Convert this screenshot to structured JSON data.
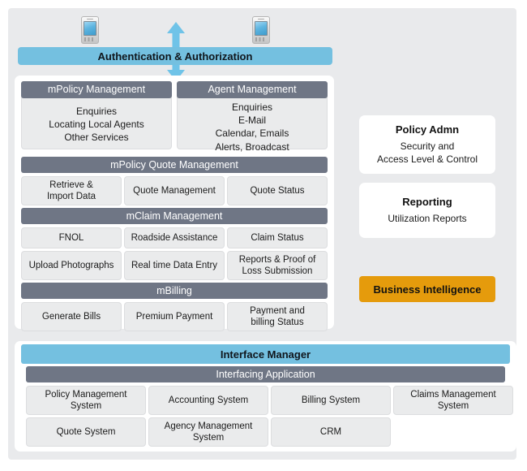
{
  "diagram": {
    "devices": [
      {
        "icon": "mobile-phone-icon"
      },
      {
        "icon": "mobile-phone-icon"
      }
    ],
    "arrow": {
      "icon": "double-headed-vertical-arrow-icon"
    },
    "auth_bar": {
      "label": "Authentication & Authorization"
    },
    "modules": [
      {
        "id": "mpolicy-management",
        "title": "mPolicy Management",
        "body": [
          "Enquiries",
          "Locating Local Agents",
          "Other Services"
        ]
      },
      {
        "id": "agent-management",
        "title": "Agent Management",
        "body": [
          "Enquiries",
          "E-Mail",
          "Calendar, Emails",
          "Alerts, Broadcast"
        ]
      }
    ],
    "sections": [
      {
        "id": "mpolicy-quote-management",
        "title": "mPolicy Quote Management",
        "rows": [
          [
            "Retrieve &\nImport Data",
            "Quote Management",
            "Quote Status"
          ]
        ]
      },
      {
        "id": "mclaim-management",
        "title": "mClaim Management",
        "rows": [
          [
            "FNOL",
            "Roadside Assistance",
            "Claim Status"
          ],
          [
            "Upload Photographs",
            "Real time Data Entry",
            "Reports & Proof of\nLoss Submission"
          ]
        ]
      },
      {
        "id": "mbilling",
        "title": "mBilling",
        "rows": [
          [
            "Generate Bills",
            "Premium Payment",
            "Payment and\nbilling  Status"
          ]
        ]
      }
    ],
    "side_cards": [
      {
        "id": "policy-admn",
        "title": "Policy Admn",
        "body": [
          "Security and",
          "Access Level & Control"
        ]
      },
      {
        "id": "reporting",
        "title": "Reporting",
        "body": [
          "Utilization Reports"
        ]
      }
    ],
    "business_intelligence": {
      "label": "Business Intelligence"
    },
    "interface_manager": {
      "label": "Interface Manager"
    },
    "interfacing_application": {
      "title": "Interfacing Application",
      "rows": [
        [
          "Policy Management\nSystem",
          "Accounting System",
          "Billing System",
          "Claims Management\nSystem"
        ],
        [
          "Quote System",
          "Agency Management\nSystem",
          "CRM",
          ""
        ]
      ]
    }
  },
  "colors": {
    "panel_bg": "#e9eaec",
    "header_gray": "#6f7685",
    "accent_blue": "#74c0e0",
    "arrow_blue": "#6fc3e8",
    "cell_gray": "#eaebec",
    "orange": "#e59b0c",
    "card_white": "#ffffff"
  }
}
